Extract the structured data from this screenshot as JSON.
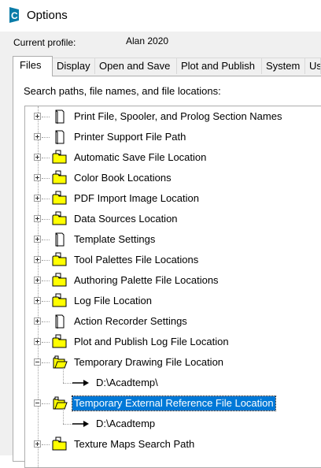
{
  "window": {
    "title": "Options",
    "icon": "autocad-c-icon"
  },
  "profile": {
    "label": "Current profile:",
    "value": "Alan 2020"
  },
  "tabs": [
    {
      "label": "Files",
      "active": true
    },
    {
      "label": "Display"
    },
    {
      "label": "Open and Save"
    },
    {
      "label": "Plot and Publish"
    },
    {
      "label": "System"
    },
    {
      "label": "Us"
    }
  ],
  "panel": {
    "caption": "Search paths, file names, and file locations:"
  },
  "tree": {
    "items": [
      {
        "label": "Print File, Spooler, and Prolog Section Names",
        "icon": "document-icon",
        "expander": "+"
      },
      {
        "label": "Printer Support File Path",
        "icon": "document-icon",
        "expander": "+"
      },
      {
        "label": "Automatic Save File Location",
        "icon": "folder-icon",
        "expander": "+"
      },
      {
        "label": "Color Book Locations",
        "icon": "folder-icon",
        "expander": "+"
      },
      {
        "label": "PDF Import Image Location",
        "icon": "folder-icon",
        "expander": "+"
      },
      {
        "label": "Data Sources Location",
        "icon": "folder-icon",
        "expander": "+"
      },
      {
        "label": "Template Settings",
        "icon": "document-icon",
        "expander": "+"
      },
      {
        "label": "Tool Palettes File Locations",
        "icon": "folder-icon",
        "expander": "+"
      },
      {
        "label": "Authoring Palette File Locations",
        "icon": "folder-icon",
        "expander": "+"
      },
      {
        "label": "Log File Location",
        "icon": "folder-icon",
        "expander": "+"
      },
      {
        "label": "Action Recorder Settings",
        "icon": "document-icon",
        "expander": "+"
      },
      {
        "label": "Plot and Publish Log File Location",
        "icon": "folder-icon",
        "expander": "+"
      },
      {
        "label": "Temporary Drawing File Location",
        "icon": "folder-open-icon",
        "expander": "-"
      },
      {
        "label": "D:\\Acadtemp\\",
        "icon": "path-arrow-icon",
        "child": true
      },
      {
        "label": "Temporary External Reference File Location",
        "icon": "folder-open-icon",
        "expander": "-",
        "selected": true
      },
      {
        "label": "D:\\Acadtemp",
        "icon": "path-arrow-icon",
        "child": true
      },
      {
        "label": "Texture Maps Search Path",
        "icon": "folder-icon",
        "expander": "+"
      }
    ]
  },
  "colors": {
    "selection": "#0078d7",
    "folder": "#ffff00",
    "window_bg": "#f0f0f0"
  }
}
